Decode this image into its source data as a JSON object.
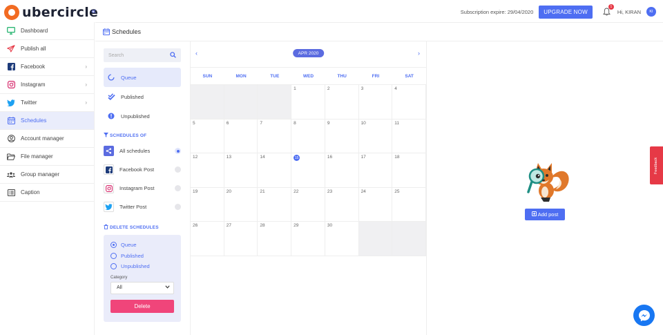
{
  "brand": {
    "name": "ubercircle",
    "accent": "#4e6ef2",
    "logo_color": "#f26b22"
  },
  "topbar": {
    "collapse_icon": "double-chevron-left-icon",
    "subscription": "Subscription expire: 29/04/2020",
    "upgrade_label": "UPGRADE NOW",
    "notification_count": "1",
    "greeting": "Hi, KIRAN",
    "avatar_initials": "KI"
  },
  "sidebar": {
    "items": [
      {
        "label": "Dashboard",
        "icon": "monitor-icon"
      },
      {
        "label": "Publish all",
        "icon": "paper-plane-icon"
      },
      {
        "label": "Facebook",
        "icon": "facebook-icon",
        "chevron": "›"
      },
      {
        "label": "Instagram",
        "icon": "instagram-icon",
        "chevron": "›"
      },
      {
        "label": "Twitter",
        "icon": "twitter-icon",
        "chevron": "›"
      },
      {
        "label": "Schedules",
        "icon": "calendar-icon",
        "active": true
      },
      {
        "label": "Account manager",
        "icon": "user-circle-icon"
      },
      {
        "label": "File manager",
        "icon": "folder-icon"
      },
      {
        "label": "Group manager",
        "icon": "users-icon"
      },
      {
        "label": "Caption",
        "icon": "list-icon"
      }
    ]
  },
  "page": {
    "title": "Schedules"
  },
  "filters": {
    "search_placeholder": "Search",
    "status": [
      {
        "label": "Queue",
        "active": true
      },
      {
        "label": "Published"
      },
      {
        "label": "Unpublished"
      }
    ],
    "schedules_of_title": "SCHEDULES OF",
    "schedules_of": [
      {
        "label": "All schedules",
        "selected": true
      },
      {
        "label": "Facebook Post"
      },
      {
        "label": "Instagram Post"
      },
      {
        "label": "Twitter Post"
      }
    ],
    "delete_title": "DELETE SCHEDULES",
    "delete_options": [
      {
        "label": "Queue",
        "selected": true
      },
      {
        "label": "Published"
      },
      {
        "label": "Unpublished"
      }
    ],
    "category_label": "Category",
    "category_value": "All",
    "delete_label": "Delete"
  },
  "calendar": {
    "month": "APR 2020",
    "prev": "‹",
    "next": "›",
    "weekdays": [
      "SUN",
      "MON",
      "TUE",
      "WED",
      "THU",
      "FRI",
      "SAT"
    ],
    "leading_empty": 3,
    "days": 30,
    "trailing_empty": 2,
    "today": "15"
  },
  "right_panel": {
    "add_post_label": "Add post"
  },
  "feedback_label": "Feedback"
}
